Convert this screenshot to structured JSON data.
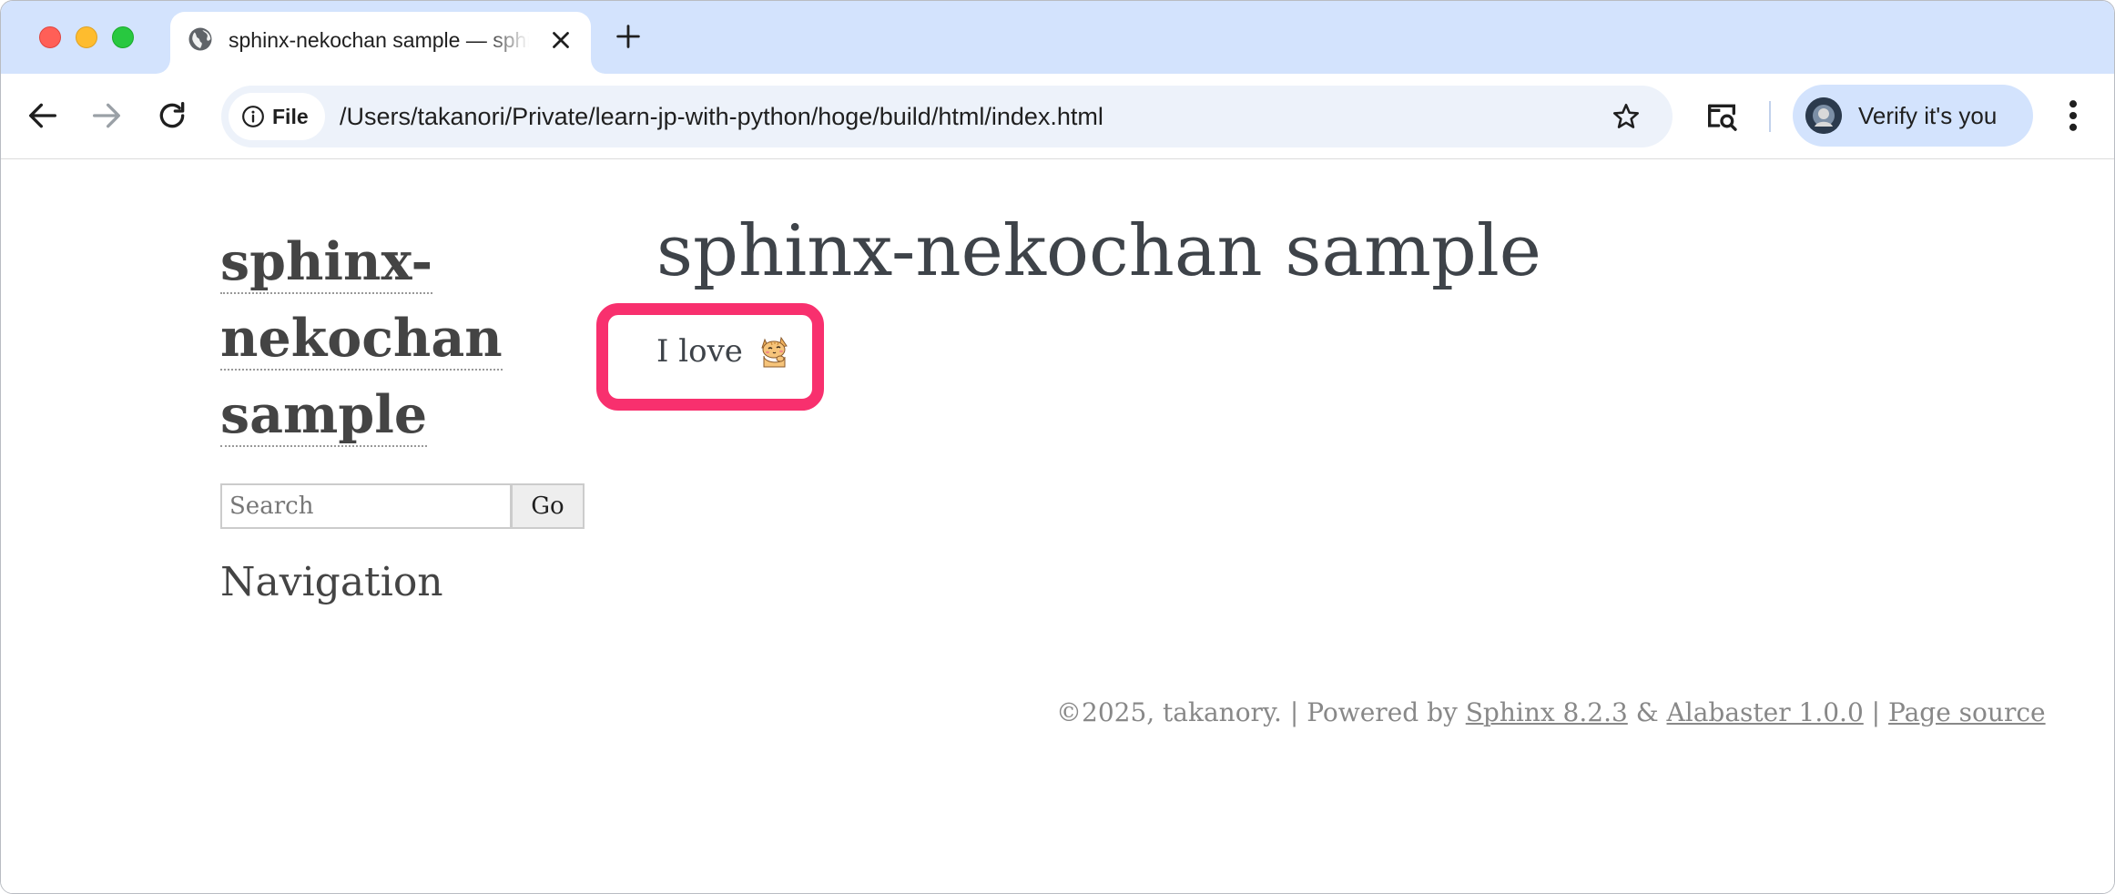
{
  "browser": {
    "tab_title": "sphinx-nekochan sample — sphinx-nekochan sample documentation",
    "address_chip_label": "File",
    "url": "/Users/takanori/Private/learn-jp-with-python/hoge/build/html/index.html",
    "profile_button_label": "Verify it's you"
  },
  "sidebar": {
    "logo_lines": [
      "sphinx-",
      "nekochan",
      "sample"
    ],
    "search_placeholder": "Search",
    "search_button": "Go",
    "navigation_heading": "Navigation"
  },
  "document": {
    "title": "sphinx-nekochan sample",
    "paragraph_text": "I love",
    "paragraph_emoji": "cat-emoji-icon"
  },
  "annotation": {
    "highlight_color": "#f8306e"
  },
  "footer": {
    "copyright": "©2025, takanory.",
    "powered_by": "Powered by",
    "sphinx_link": "Sphinx 8.2.3",
    "amp": "&",
    "alabaster_link": "Alabaster 1.0.0",
    "separator": "|",
    "page_source_link": "Page source"
  },
  "colors": {
    "tabstrip": "#d3e3fd",
    "omnibox": "#edf2fa",
    "text": "#3e4349",
    "footer_text": "#888888"
  }
}
